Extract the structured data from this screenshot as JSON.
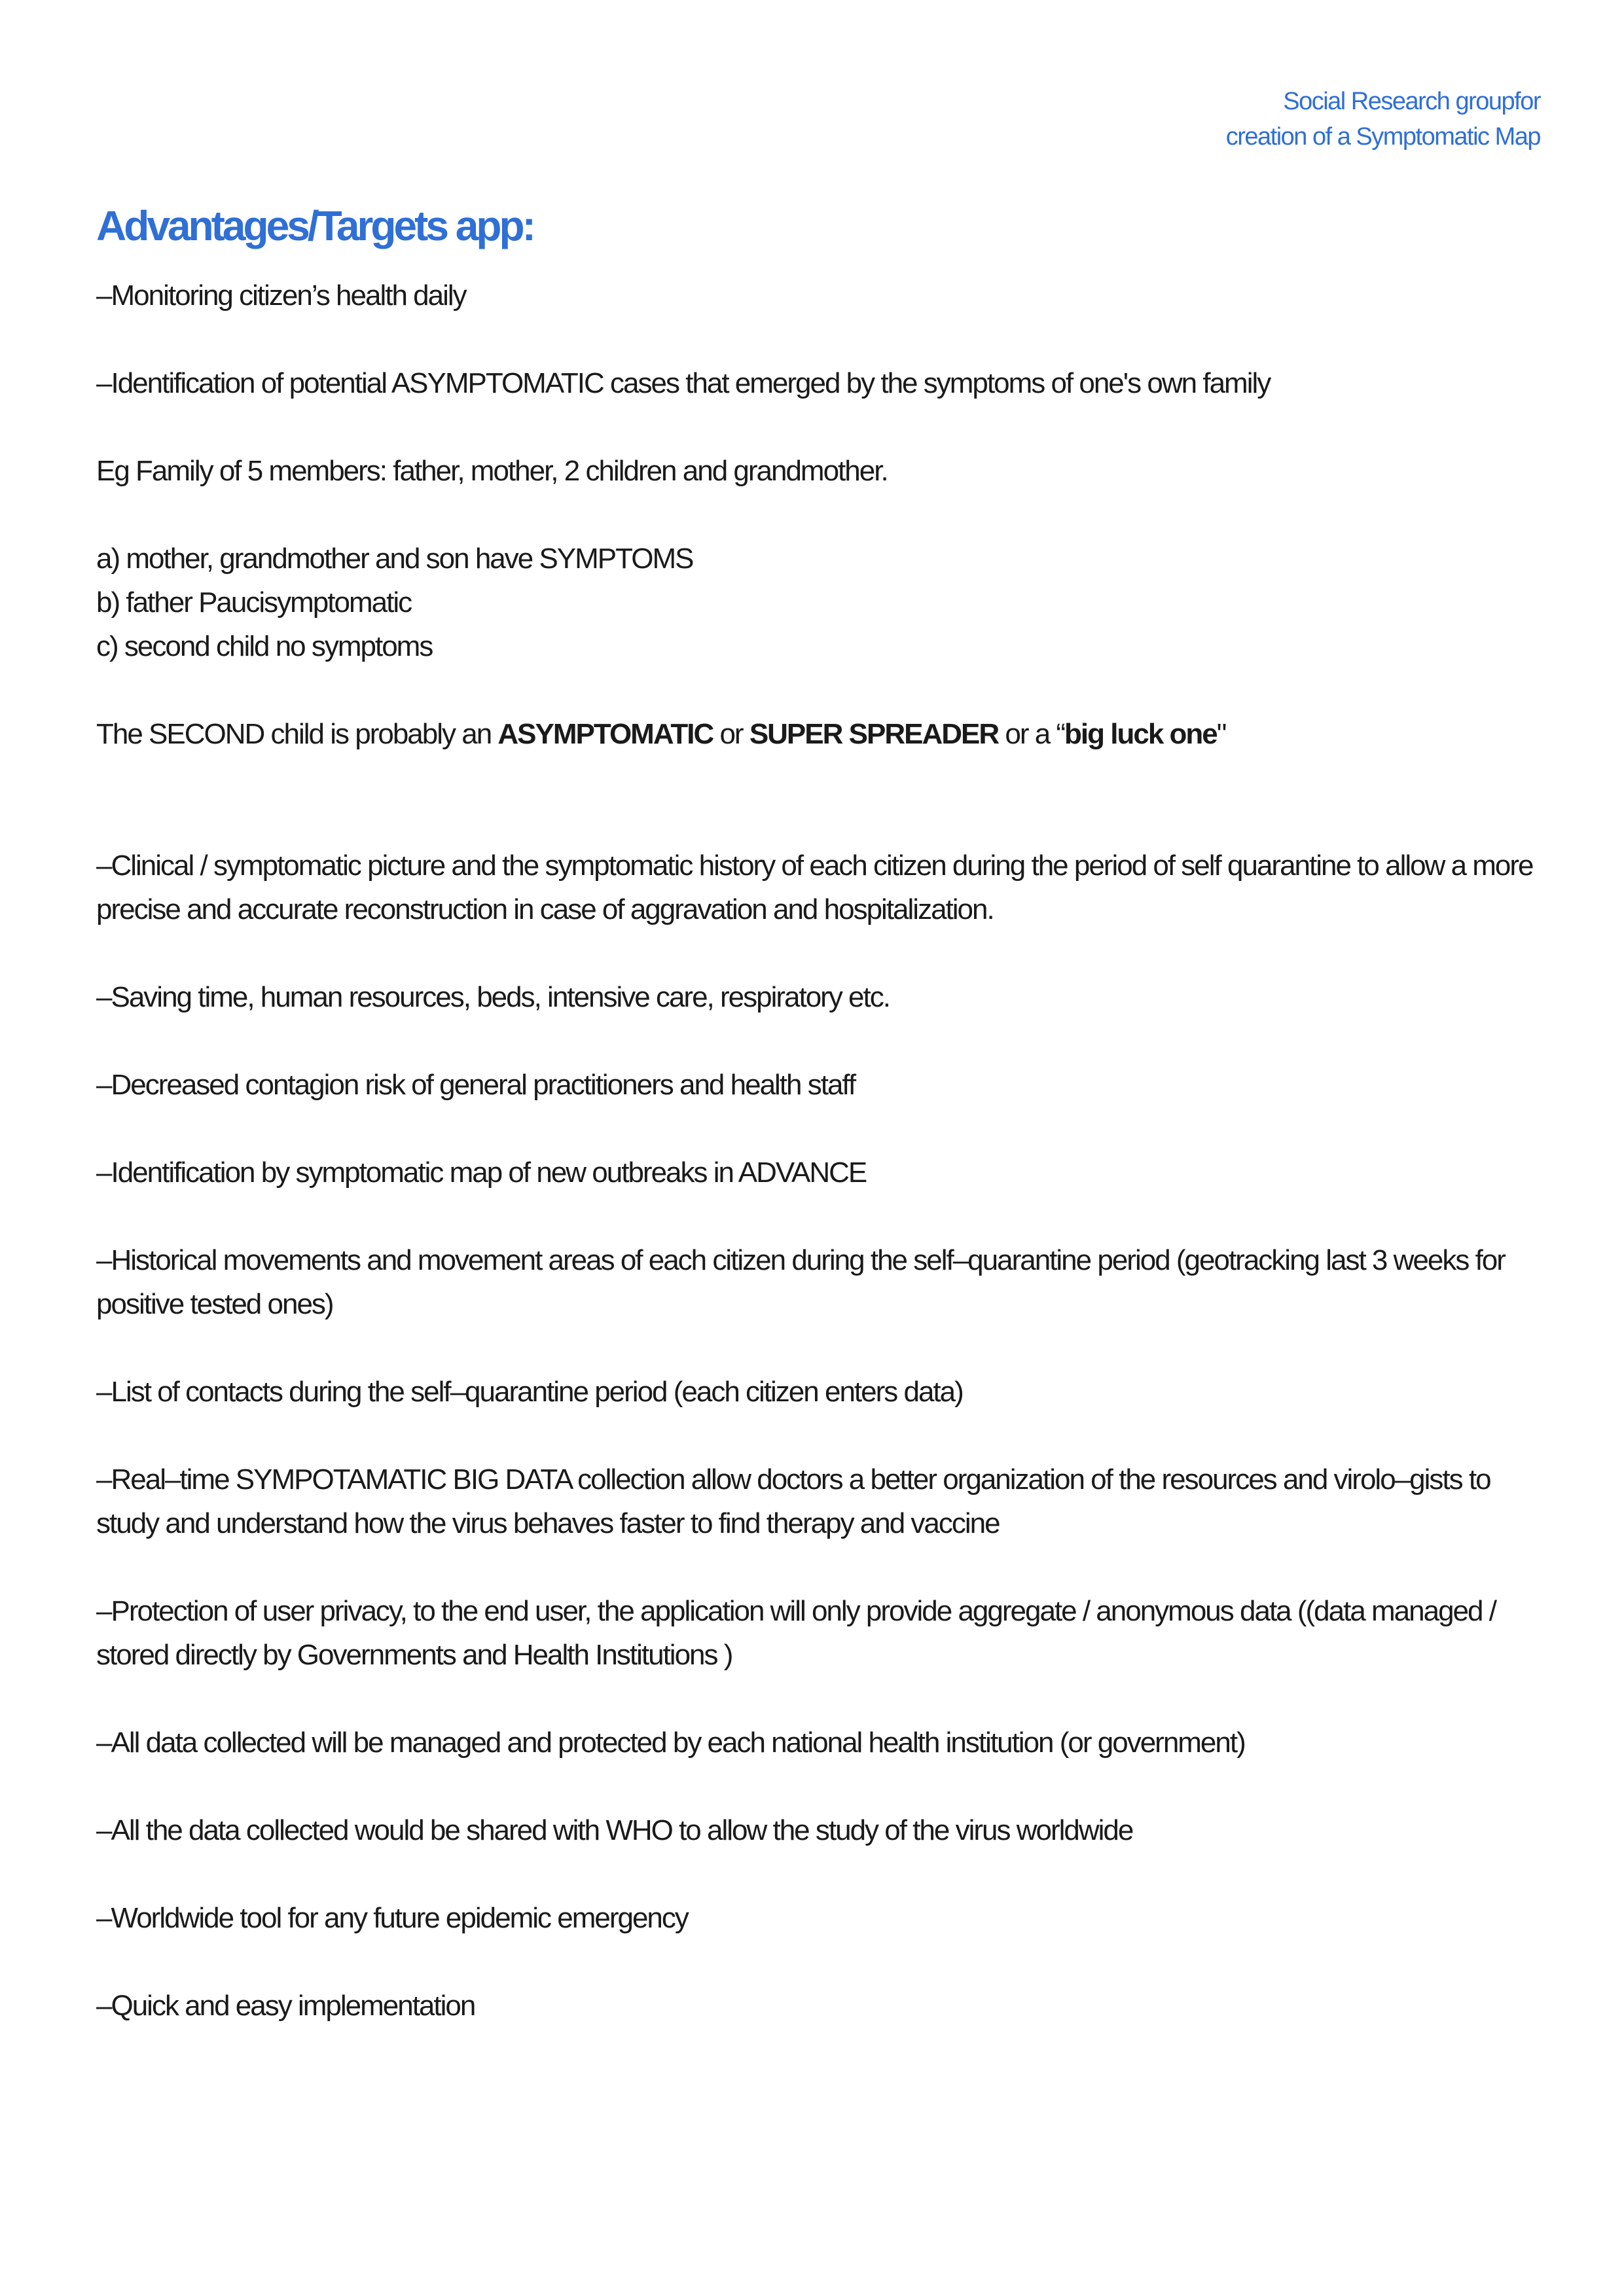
{
  "header": {
    "line1": "Social Research groupfor",
    "line2": "creation of a Symptomatic Map"
  },
  "title": "Advantages/Targets app:",
  "items": {
    "monitoring": "–Monitoring citizen’s health daily",
    "identification_asymptomatic": "–Identification of potential ASYMPTOMATIC cases that emerged by the symptoms of one's own family",
    "example_intro": "Eg Family of 5 members: father, mother, 2 children and grandmother.",
    "example_a": "a) mother, grandmother and son have SYMPTOMS",
    "example_b": "b) father Paucisymptomatic",
    "example_c": "c) second child no symptoms",
    "conclusion": {
      "prefix": "The SECOND child is probably an ",
      "bold1": "ASYMPTOMATIC",
      "middle": " or ",
      "bold2": "SUPER SPREADER",
      "suffix1": " or a “",
      "bold3": "big luck one",
      "suffix2": "\""
    },
    "clinical": "–Clinical / symptomatic picture and the symptomatic history of each citizen during the period of self quarantine to allow a more precise and accurate reconstruction in case of aggravation and hospitalization.",
    "saving": "–Saving time, human resources, beds, intensive care, respiratory etc.",
    "contagion": "–Decreased contagion risk of general practitioners and health staff",
    "outbreaks": "–Identification by symptomatic map of new outbreaks in ADVANCE",
    "movements": "–Historical movements and movement areas of each citizen during the self–quarantine period (geotracking last 3 weeks for positive tested ones)",
    "contacts": "–List of contacts during the self–quarantine period (each citizen enters data)",
    "bigdata": "–Real–time SYMPOTAMATIC BIG DATA collection allow doctors a better organization of the resources and virolo–gists to study and understand how the virus behaves faster to find therapy and vaccine",
    "privacy": "–Protection of user privacy, to the end user, the application will only provide aggregate / anonymous data ((data managed / stored directly by Governments and Health Institutions )",
    "managed": "–All data collected will be managed and protected by each national health institution (or government)",
    "who": "–All the data collected would be shared with WHO to allow the study of the virus worldwide",
    "worldwide": "–Worldwide tool for any future epidemic emergency",
    "quick": "–Quick and easy implementation"
  }
}
